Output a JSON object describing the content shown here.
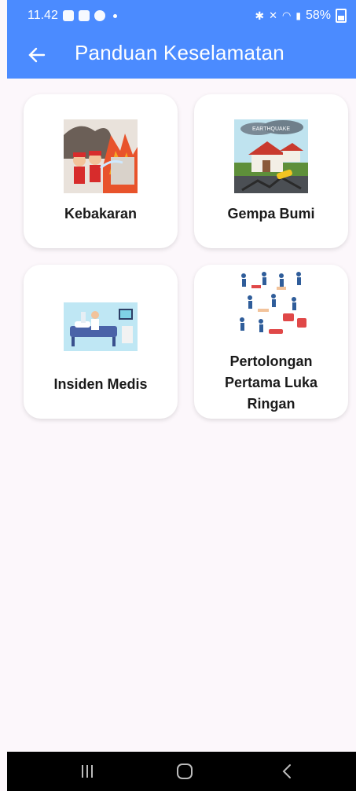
{
  "status_bar": {
    "time": "11.42",
    "battery": "58%"
  },
  "app_bar": {
    "back_icon": "back-arrow-icon",
    "title": "Panduan Keselamatan"
  },
  "cards": [
    {
      "label": "Kebakaran",
      "icon": "fire-illustration"
    },
    {
      "label": "Gempa Bumi",
      "icon": "earthquake-illustration",
      "image_text": "EARTHQUAKE"
    },
    {
      "label": "Insiden Medis",
      "icon": "medical-illustration"
    },
    {
      "label": "Pertolongan Pertama Luka Ringan",
      "icon": "first-aid-illustration"
    }
  ],
  "nav_bar": {
    "recents_icon": "recents-icon",
    "home_icon": "home-icon",
    "back_icon": "back-chevron-icon"
  },
  "colors": {
    "app_bar": "#4b8bff",
    "background": "#fcf7fb",
    "card": "#ffffff"
  }
}
